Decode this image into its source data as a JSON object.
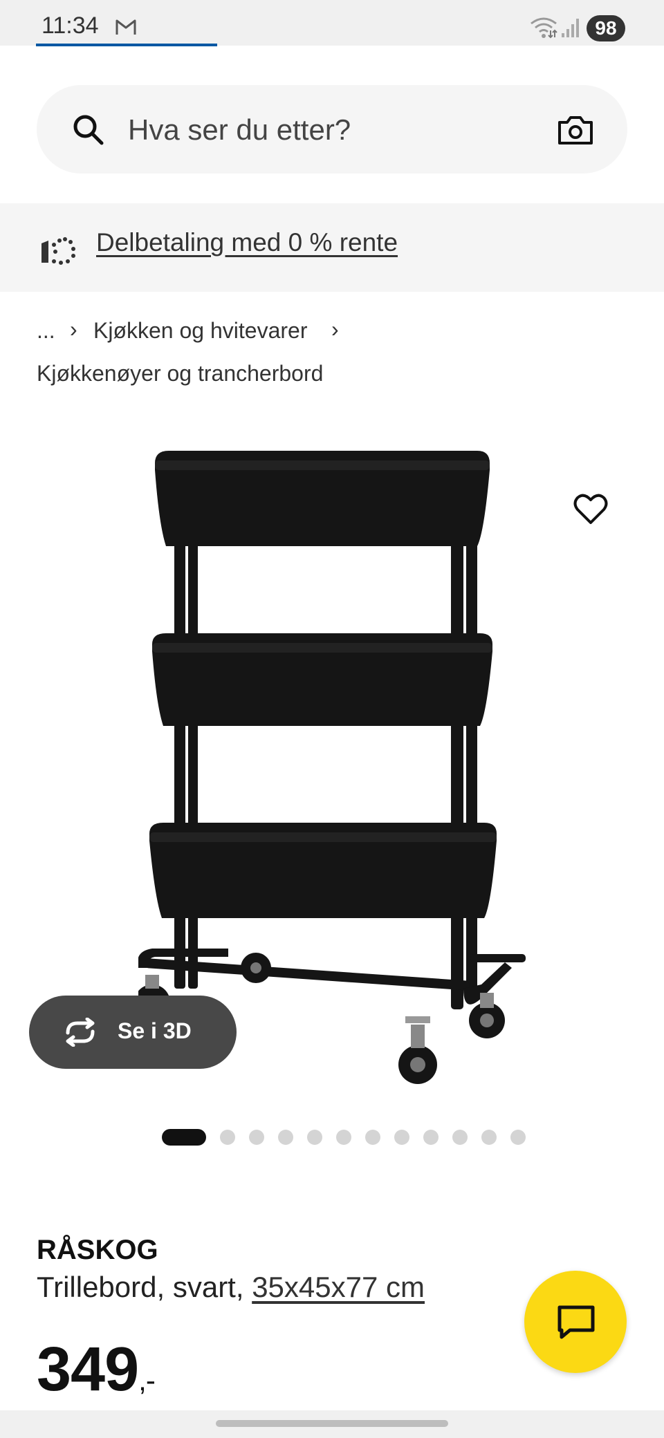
{
  "status_bar": {
    "time": "11:34",
    "battery": "98"
  },
  "search": {
    "placeholder": "Hva ser du etter?"
  },
  "promo": {
    "text": "Delbetaling med 0 % rente"
  },
  "breadcrumb": {
    "ellipsis": "...",
    "separator": "›",
    "parent": "Kjøkken og hvitevarer",
    "current": "Kjøkkenøyer og trancherbord"
  },
  "gallery": {
    "view_3d_label": "Se i 3D",
    "total_images": 12,
    "active_index": 0
  },
  "product": {
    "name": "RÅSKOG",
    "description": "Trillebord, svart, ",
    "dimensions": "35x45x77 cm",
    "price": "349",
    "price_suffix": ",-"
  },
  "colors": {
    "accent_blue": "#0058a3",
    "chat_yellow": "#fbd914",
    "button_dark": "#484848"
  },
  "icons": [
    "gmail-icon",
    "wifi-icon",
    "signal-icon",
    "search-icon",
    "camera-icon",
    "installment-icon",
    "heart-icon",
    "rotate-3d-icon",
    "chat-icon"
  ]
}
